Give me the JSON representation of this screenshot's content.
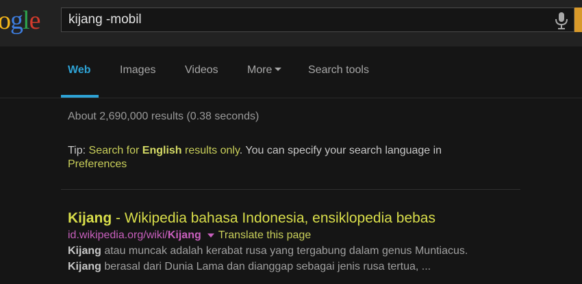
{
  "logo": {
    "letters": [
      "o",
      "g",
      "l",
      "e"
    ]
  },
  "search": {
    "query": "kijang -mobil"
  },
  "tabs": [
    {
      "label": "Web"
    },
    {
      "label": "Images"
    },
    {
      "label": "Videos"
    },
    {
      "label": "More"
    },
    {
      "label": "Search tools"
    }
  ],
  "stats": "About 2,690,000 results (0.38 seconds)",
  "tip": {
    "prefix": "Tip: ",
    "link_pre": "Search for ",
    "link_bold": "English",
    "link_post": " results only",
    "middle": ". You can specify your search language in ",
    "prefs": "Preferences"
  },
  "results": [
    {
      "title_bold": "Kijang",
      "title_rest": " - Wikipedia bahasa Indonesia, ensiklopedia bebas",
      "url_pre": "id.wikipedia.org/wiki/",
      "url_bold": "Kijang",
      "translate": "Translate this page",
      "snippet1_bold": "Kijang",
      "snippet1_rest": " atau muncak adalah kerabat rusa yang tergabung dalam genus Muntiacus.",
      "snippet2_bold": "Kijang",
      "snippet2_rest": " berasal dari Dunia Lama dan dianggap sebagai jenis rusa tertua, ..."
    }
  ],
  "colors": {
    "accent": "#2ea3d6",
    "link": "#d9de4a",
    "url": "#c85fbd",
    "search_button": "#d8992a"
  }
}
